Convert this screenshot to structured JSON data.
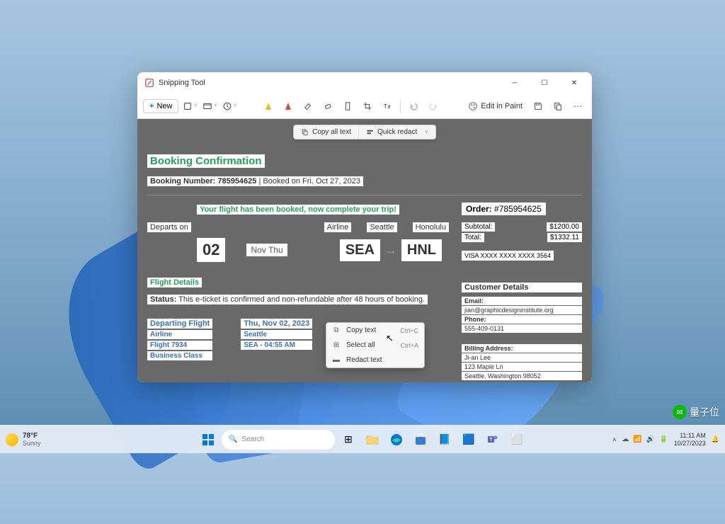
{
  "window": {
    "title": "Snipping Tool",
    "new_label": "New",
    "edit_paint_label": "Edit in Paint"
  },
  "action_bar": {
    "copy_all": "Copy all text",
    "quick_redact": "Quick redact"
  },
  "booking": {
    "title": "Booking Confirmation",
    "number_label": "Booking Number:",
    "number": "785954625",
    "booked_on": "Booked on Fri. Oct 27, 2023",
    "banner": "Your flight has been booked, now complete your trip!",
    "departs_on": "Departs on",
    "day": "02",
    "month_day": "Nov Thu",
    "col_airline": "Airline",
    "col_from": "Seattle",
    "col_to": "Honolulu",
    "from_code": "SEA",
    "to_code": "HNL"
  },
  "order": {
    "title_label": "Order:",
    "title_num": "#785954625",
    "subtotal_label": "Subtotal:",
    "subtotal_val": "$1200.00",
    "total_label": "Total:",
    "total_val": "$1332.11",
    "card": "VISA XXXX XXXX XXXX 3564"
  },
  "details": {
    "title": "Flight Details",
    "status_label": "Status:",
    "status_text": "This e-ticket is confirmed and non-refundable after 48 hours of booking."
  },
  "departing": {
    "title": "Departing Flight",
    "airline": "Airline",
    "flight": "Flight 7934",
    "class": "Business Class",
    "date": "Thu, Nov 02, 2023",
    "city": "Seattle",
    "time": "SEA - 04:55 AM"
  },
  "customer": {
    "title": "Customer Details",
    "email_label": "Email:",
    "email": "jian@graphicdesigninstitute.org",
    "phone_label": "Phone:",
    "phone": "555-409-0131",
    "billing_label": "Billing Address:",
    "name": "Ji-an Lee",
    "addr1": "123 Maple Ln",
    "addr2": "Seattle, Washington 98052"
  },
  "context_menu": {
    "copy_text": "Copy text",
    "copy_shortcut": "Ctrl+C",
    "select_all": "Select all",
    "select_shortcut": "Ctrl+A",
    "redact": "Redact text"
  },
  "taskbar": {
    "temp": "78°F",
    "condition": "Sunny",
    "search_placeholder": "Search",
    "time": "11:11 AM",
    "date": "10/27/2023"
  },
  "watermark": "量子位"
}
